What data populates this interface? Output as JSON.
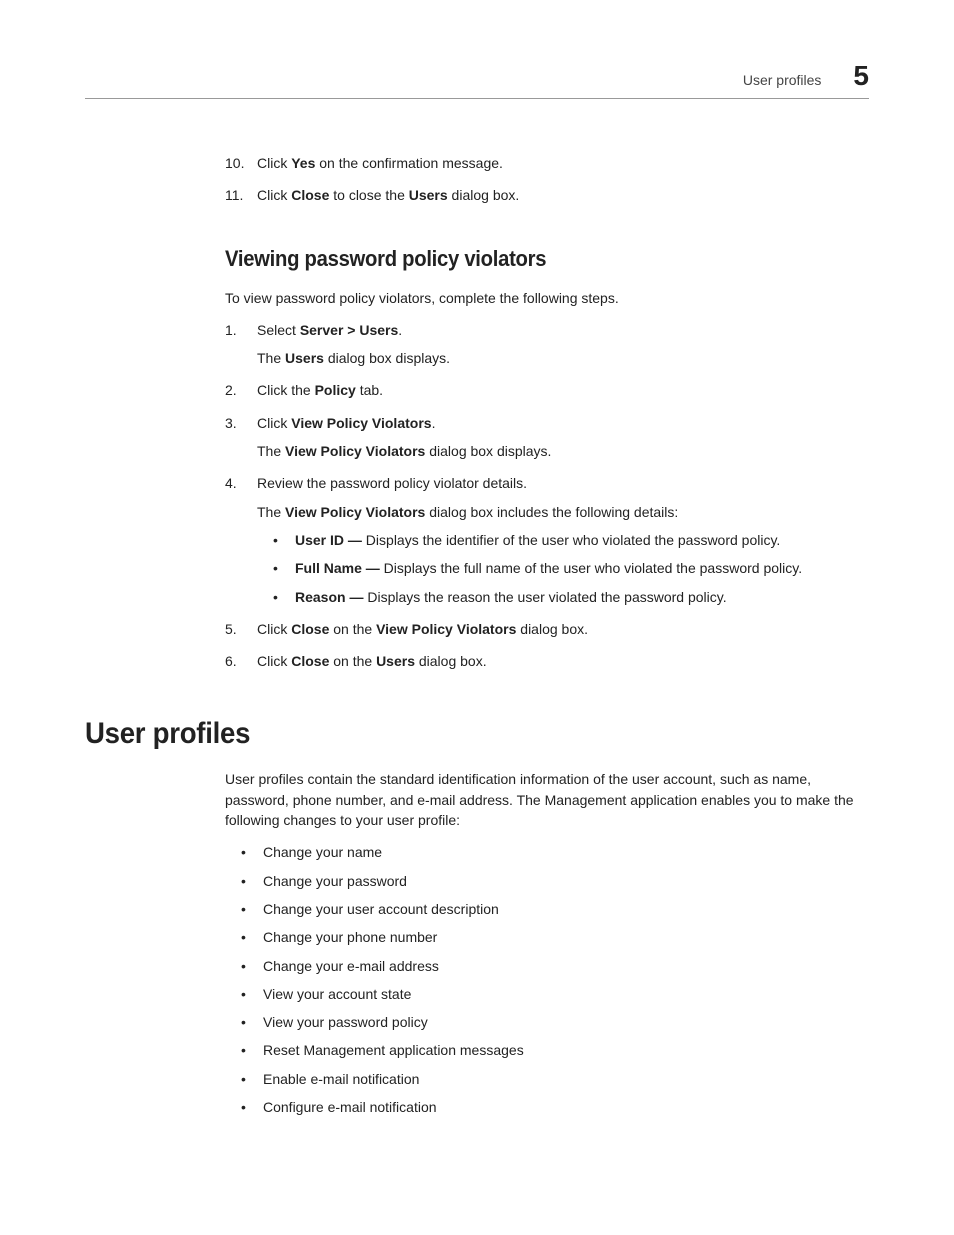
{
  "header": {
    "title": "User profiles",
    "chapter": "5"
  },
  "steps_top": {
    "s10": {
      "num": "10.",
      "pre": "Click ",
      "b1": "Yes",
      "post": " on the confirmation message."
    },
    "s11": {
      "num": "11.",
      "pre": "Click ",
      "b1": "Close",
      "mid": " to close the ",
      "b2": "Users",
      "post": " dialog box."
    }
  },
  "section1": {
    "title": "Viewing password policy violators",
    "intro": "To view password policy violators, complete the following steps.",
    "s1": {
      "num": "1.",
      "pre": "Select ",
      "b1": "Server > Users",
      "post": ".",
      "sub_pre": "The ",
      "sub_b": "Users",
      "sub_post": " dialog box displays."
    },
    "s2": {
      "num": "2.",
      "pre": "Click the ",
      "b1": "Policy",
      "post": " tab."
    },
    "s3": {
      "num": "3.",
      "pre": "Click ",
      "b1": "View Policy Violators",
      "post": ".",
      "sub_pre": "The ",
      "sub_b": "View Policy Violators",
      "sub_post": " dialog box displays."
    },
    "s4": {
      "num": "4.",
      "text": "Review the password policy violator details.",
      "sub_pre": "The ",
      "sub_b": "View Policy Violators",
      "sub_post": " dialog box includes the following details:",
      "bul1_b": "User ID —",
      "bul1_t": " Displays the identifier of the user who violated the password policy.",
      "bul2_b": "Full Name —",
      "bul2_t": " Displays the full name of the user who violated the password policy.",
      "bul3_b": "Reason —",
      "bul3_t": " Displays the reason the user violated the password policy."
    },
    "s5": {
      "num": "5.",
      "pre": "Click ",
      "b1": "Close",
      "mid": " on the ",
      "b2": "View Policy Violators",
      "post": " dialog box."
    },
    "s6": {
      "num": "6.",
      "pre": "Click ",
      "b1": "Close",
      "mid": " on the ",
      "b2": "Users",
      "post": " dialog box."
    }
  },
  "section2": {
    "title": "User profiles",
    "intro": "User profiles contain the standard identification information of the user account, such as name, password, phone number, and e-mail address. The Management application enables you to make the following changes to your user profile:",
    "bullets": [
      "Change your name",
      "Change your password",
      "Change your user account description",
      "Change your phone number",
      "Change your e-mail address",
      "View your account state",
      "View your password policy",
      "Reset Management application messages",
      "Enable e-mail notification",
      "Configure e-mail notification"
    ]
  }
}
